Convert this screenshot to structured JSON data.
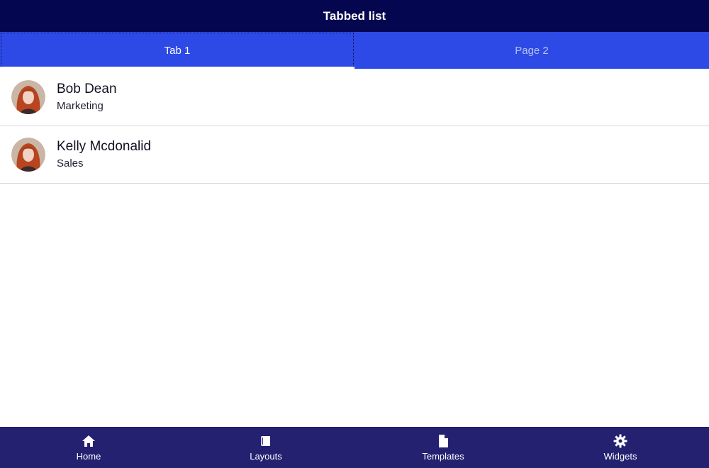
{
  "header": {
    "title": "Tabbed list"
  },
  "tabs": [
    {
      "label": "Tab 1",
      "active": true
    },
    {
      "label": "Page 2",
      "active": false
    }
  ],
  "list": [
    {
      "name": "Bob Dean",
      "department": "Marketing"
    },
    {
      "name": "Kelly Mcdonalid",
      "department": "Sales"
    }
  ],
  "nav": [
    {
      "label": "Home",
      "icon": "home-icon"
    },
    {
      "label": "Layouts",
      "icon": "book-icon"
    },
    {
      "label": "Templates",
      "icon": "document-icon"
    },
    {
      "label": "Widgets",
      "icon": "gear-icon"
    }
  ],
  "colors": {
    "header_bg": "#04074f",
    "tab_bg": "#2d4ae6",
    "nav_bg": "#232170"
  }
}
